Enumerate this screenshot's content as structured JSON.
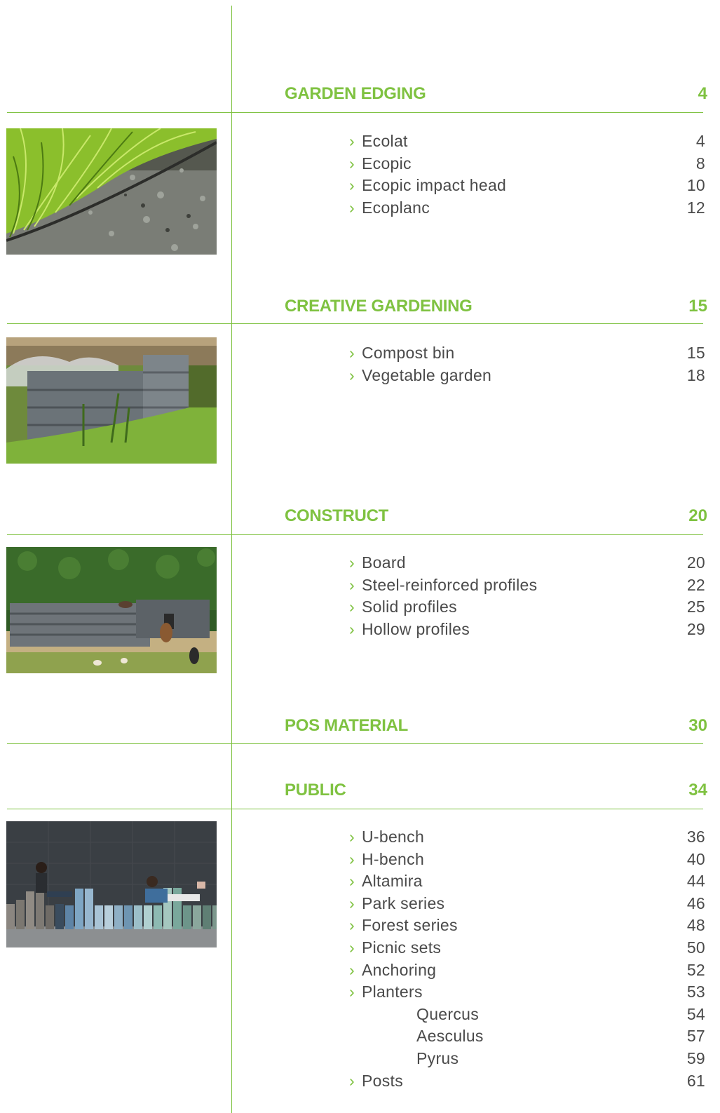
{
  "sections": [
    {
      "title": "GARDEN EDGING",
      "page": "4",
      "image": "ornamental-grass-gravel-edging-photo",
      "items": [
        {
          "label": "Ecolat",
          "page": "4"
        },
        {
          "label": "Ecopic",
          "page": "8"
        },
        {
          "label": "Ecopic impact head",
          "page": "10"
        },
        {
          "label": "Ecoplanc",
          "page": "12"
        }
      ]
    },
    {
      "title": "CREATIVE GARDENING",
      "page": "15",
      "image": "compost-bins-garden-photo",
      "items": [
        {
          "label": "Compost bin",
          "page": "15"
        },
        {
          "label": "Vegetable garden",
          "page": "18"
        }
      ]
    },
    {
      "title": "CONSTRUCT",
      "page": "20",
      "image": "goat-enclosure-fence-photo",
      "items": [
        {
          "label": "Board",
          "page": "20"
        },
        {
          "label": "Steel-reinforced profiles",
          "page": "22"
        },
        {
          "label": "Solid profiles",
          "page": "25"
        },
        {
          "label": "Hollow profiles",
          "page": "29"
        }
      ]
    },
    {
      "title": "POS MATERIAL",
      "page": "30",
      "items": []
    },
    {
      "title": "PUBLIC",
      "page": "34",
      "image": "people-on-colored-bench-photo",
      "items": [
        {
          "label": "U-bench",
          "page": "36"
        },
        {
          "label": "H-bench",
          "page": "40"
        },
        {
          "label": "Altamira",
          "page": "44"
        },
        {
          "label": "Park series",
          "page": "46"
        },
        {
          "label": "Forest series",
          "page": "48"
        },
        {
          "label": "Picnic sets",
          "page": "50"
        },
        {
          "label": "Anchoring",
          "page": "52"
        },
        {
          "label": "Planters",
          "page": "53"
        },
        {
          "label": "Quercus",
          "page": "54",
          "sub": true
        },
        {
          "label": "Aesculus",
          "page": "57",
          "sub": true
        },
        {
          "label": "Pyrus",
          "page": "59",
          "sub": true
        },
        {
          "label": "Posts",
          "page": "61"
        }
      ]
    }
  ],
  "chevron": "›",
  "colors": {
    "accent": "#7fc241",
    "text": "#4a4a4a"
  }
}
